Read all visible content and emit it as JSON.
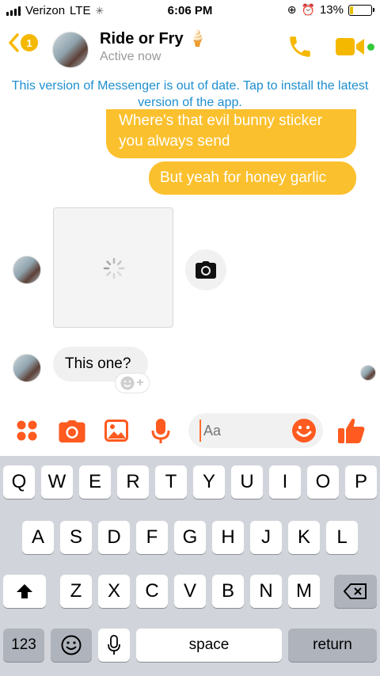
{
  "status_bar": {
    "carrier": "Verizon",
    "network": "LTE",
    "time": "6:06 PM",
    "battery": "13%"
  },
  "header": {
    "back_badge": "1",
    "name": "Ride or Fry 🍦",
    "status": "Active now",
    "accent_color": "#f5b800",
    "online_color": "#35c83a"
  },
  "banner": {
    "text": "This version of Messenger is out of date. Tap to install the latest version of the app."
  },
  "messages": [
    {
      "from": "me",
      "text": "Where's that evil bunny sticker you always send"
    },
    {
      "from": "me",
      "text": "But yeah for honey garlic"
    },
    {
      "from": "them",
      "type": "photo"
    },
    {
      "from": "them",
      "text": "This one?"
    }
  ],
  "composer": {
    "placeholder": "Aa",
    "icon_color": "#ff5a1f"
  },
  "keyboard": {
    "row1": [
      "Q",
      "W",
      "E",
      "R",
      "T",
      "Y",
      "U",
      "I",
      "O",
      "P"
    ],
    "row2": [
      "A",
      "S",
      "D",
      "F",
      "G",
      "H",
      "J",
      "K",
      "L"
    ],
    "row3": [
      "Z",
      "X",
      "C",
      "V",
      "B",
      "N",
      "M"
    ],
    "numbers_label": "123",
    "space_label": "space",
    "return_label": "return"
  }
}
